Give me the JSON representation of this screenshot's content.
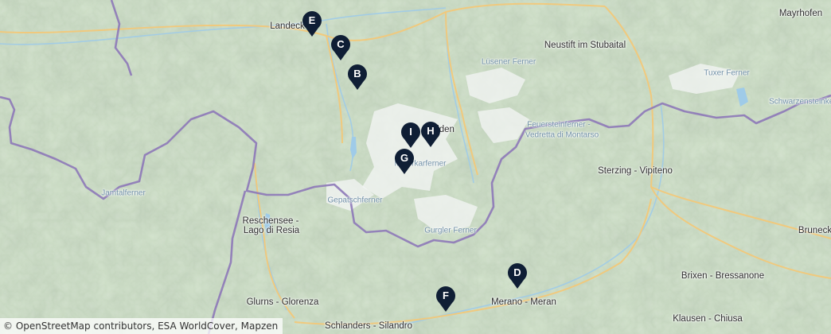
{
  "map": {
    "places": [
      {
        "id": "landeck",
        "label": "Landeck",
        "kind": "town"
      },
      {
        "id": "mayrhofen",
        "label": "Mayrhofen",
        "kind": "town"
      },
      {
        "id": "neustift",
        "label": "Neustift im Stubaital",
        "kind": "town"
      },
      {
        "id": "luesener",
        "label": "Lüsener Ferner",
        "kind": "glacier"
      },
      {
        "id": "tuxer",
        "label": "Tuxer Ferner",
        "kind": "glacier"
      },
      {
        "id": "schwarzenstein",
        "label": "Schwarzensteinkees",
        "kind": "glacier"
      },
      {
        "id": "soelden",
        "label": "Sölden",
        "kind": "town"
      },
      {
        "id": "feuerstein",
        "label": "Feuersteinferner -",
        "kind": "glacier"
      },
      {
        "id": "vedretta",
        "label": "Vedretta di Montarso",
        "kind": "glacier"
      },
      {
        "id": "sterzing",
        "label": "Sterzing - Vipiteno",
        "kind": "town"
      },
      {
        "id": "mitterkar",
        "label": "Mitterkarferner",
        "kind": "glacier"
      },
      {
        "id": "jamtal",
        "label": "Jamtalferner",
        "kind": "glacier"
      },
      {
        "id": "gepatsch",
        "label": "Gepatschferner",
        "kind": "glacier"
      },
      {
        "id": "reschensee1",
        "label": "Reschensee -",
        "kind": "town"
      },
      {
        "id": "reschensee2",
        "label": "Lago di Resia",
        "kind": "town"
      },
      {
        "id": "gurgler",
        "label": "Gurgler Ferner",
        "kind": "glacier"
      },
      {
        "id": "bruneck",
        "label": "Bruneck",
        "kind": "town"
      },
      {
        "id": "brixen",
        "label": "Brixen - Bressanone",
        "kind": "town"
      },
      {
        "id": "glurns",
        "label": "Glurns - Glorenza",
        "kind": "town"
      },
      {
        "id": "merano",
        "label": "Merano - Meran",
        "kind": "town"
      },
      {
        "id": "klausen",
        "label": "Klausen - Chiusa",
        "kind": "town"
      },
      {
        "id": "schlanders",
        "label": "Schlanders - Silandro",
        "kind": "town"
      }
    ],
    "markers": [
      {
        "id": "E",
        "label": "E"
      },
      {
        "id": "C",
        "label": "C"
      },
      {
        "id": "B",
        "label": "B"
      },
      {
        "id": "I",
        "label": "I"
      },
      {
        "id": "H",
        "label": "H"
      },
      {
        "id": "G",
        "label": "G"
      },
      {
        "id": "D",
        "label": "D"
      },
      {
        "id": "F",
        "label": "F"
      }
    ],
    "colors": {
      "terrain": "#cfe0c8",
      "snow": "#f4f6f6",
      "border": "#8d78b8",
      "road": "#f2c879",
      "river": "#9fcbe8",
      "marker": "#0f1e35"
    },
    "attribution": "© OpenStreetMap contributors, ESA WorldCover, Mapzen"
  }
}
